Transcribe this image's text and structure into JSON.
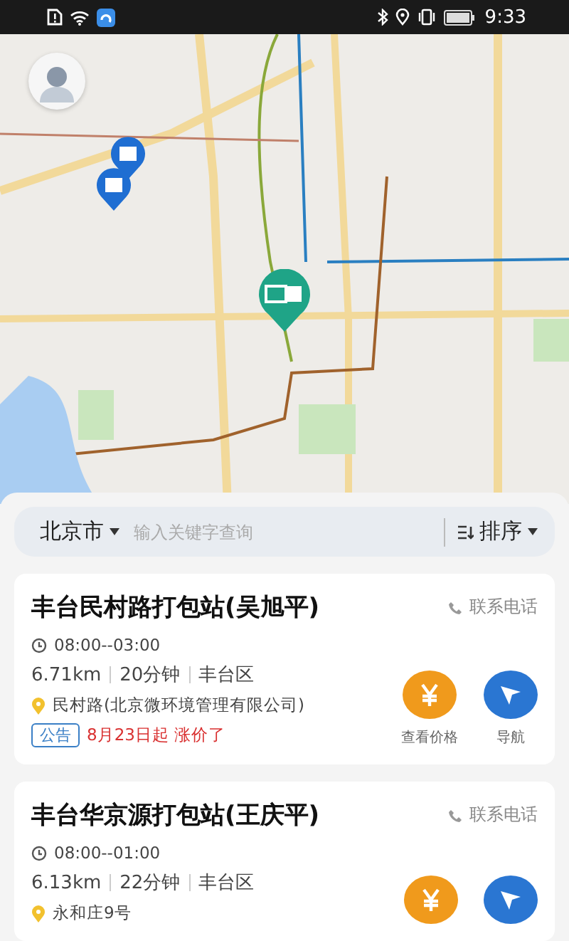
{
  "status_bar": {
    "time": "9:33"
  },
  "search": {
    "city": "北京市",
    "placeholder": "输入关键字查询",
    "sort_label": "排序"
  },
  "stations": [
    {
      "name": "丰台民村路打包站(吴旭平)",
      "contact": "联系电话",
      "hours": "08:00--03:00",
      "distance": "6.71km",
      "duration": "20分钟",
      "district": "丰台区",
      "address": "民村路(北京微环境管理有限公司)",
      "notice": {
        "tag": "公告",
        "text": "8月23日起 涨价了"
      },
      "price_label": "查看价格",
      "nav_label": "导航"
    },
    {
      "name": "丰台华京源打包站(王庆平)",
      "contact": "联系电话",
      "hours": "08:00--01:00",
      "distance": "6.13km",
      "duration": "22分钟",
      "district": "丰台区",
      "address": "永和庄9号"
    }
  ]
}
